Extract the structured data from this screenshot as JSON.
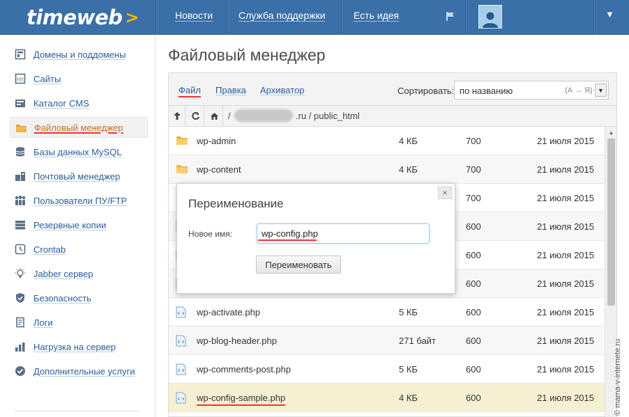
{
  "header": {
    "logo_text": "timeweb",
    "logo_arrow": ">",
    "nav": [
      "Новости",
      "Служба поддержки",
      "Есть идея"
    ],
    "flag_icon": "flag-icon",
    "avatar_icon": "user-icon",
    "menu_caret": "▼"
  },
  "sidebar": {
    "items": [
      {
        "label": "Домены и поддомены",
        "icon": "domains-icon"
      },
      {
        "label": "Сайты",
        "icon": "sites-icon"
      },
      {
        "label": "Каталог CMS",
        "icon": "cms-icon"
      },
      {
        "label": "Файловый менеджер",
        "icon": "folder-icon",
        "active": true
      },
      {
        "label": "Базы данных MySQL",
        "icon": "database-icon"
      },
      {
        "label": "Почтовый менеджер",
        "icon": "mail-icon"
      },
      {
        "label": "Пользователи ПУ/FTP",
        "icon": "users-icon"
      },
      {
        "label": "Резервные копии",
        "icon": "backup-icon"
      },
      {
        "label": "Crontab",
        "icon": "clock-icon"
      },
      {
        "label": "Jabber сервер",
        "icon": "bulb-icon"
      },
      {
        "label": "Безопасность",
        "icon": "shield-icon"
      },
      {
        "label": "Логи",
        "icon": "logs-icon"
      },
      {
        "label": "Нагрузка на сервер",
        "icon": "chart-icon"
      },
      {
        "label": "Дополнительные услуги",
        "icon": "check-badge-icon"
      }
    ]
  },
  "main": {
    "title": "Файловый менеджер",
    "toolbar": {
      "tabs": [
        "Файл",
        "Правка",
        "Архиватор"
      ],
      "sort_label": "Сортировать:",
      "sort_value": "по названию",
      "sort_hint": "(А → Я)"
    },
    "path": {
      "slash": "/",
      "text": ".ru / public_html"
    },
    "files": [
      {
        "name": "wp-admin",
        "type": "folder",
        "size": "4 КБ",
        "perm": "700",
        "date": "21 июля 2015"
      },
      {
        "name": "wp-content",
        "type": "folder",
        "size": "4 КБ",
        "perm": "700",
        "date": "21 июля 2015"
      },
      {
        "name": "",
        "type": "folder",
        "size": "",
        "perm": "700",
        "date": "21 июля 2015"
      },
      {
        "name": "",
        "type": "file",
        "size": "",
        "perm": "600",
        "date": "21 июля 2015"
      },
      {
        "name": "",
        "type": "file",
        "size": "",
        "perm": "600",
        "date": "21 июля 2015"
      },
      {
        "name": "",
        "type": "file",
        "size": "",
        "perm": "600",
        "date": "21 июля 2015"
      },
      {
        "name": "wp-activate.php",
        "type": "file",
        "size": "5 КБ",
        "perm": "600",
        "date": "21 июля 2015"
      },
      {
        "name": "wp-blog-header.php",
        "type": "file",
        "size": "271 байт",
        "perm": "600",
        "date": "21 июля 2015"
      },
      {
        "name": "wp-comments-post.php",
        "type": "file",
        "size": "5 КБ",
        "perm": "600",
        "date": "21 июля 2015"
      },
      {
        "name": "wp-config-sample.php",
        "type": "file",
        "size": "4 КБ",
        "perm": "600",
        "date": "21 июля 2015",
        "selected": true
      }
    ]
  },
  "dialog": {
    "title": "Переименование",
    "field_label": "Новое имя:",
    "field_value": "wp-config.php",
    "button_label": "Переименовать",
    "close_label": "×"
  },
  "watermark": "© mama-v-internete.ru",
  "colors": {
    "header_bg": "#3a6fa8",
    "accent_arrow": "#f5b700",
    "link": "#2a5d9b",
    "active_link": "#c5701a",
    "annotation_red": "#ee3333",
    "selected_row": "#f5f0d2"
  }
}
